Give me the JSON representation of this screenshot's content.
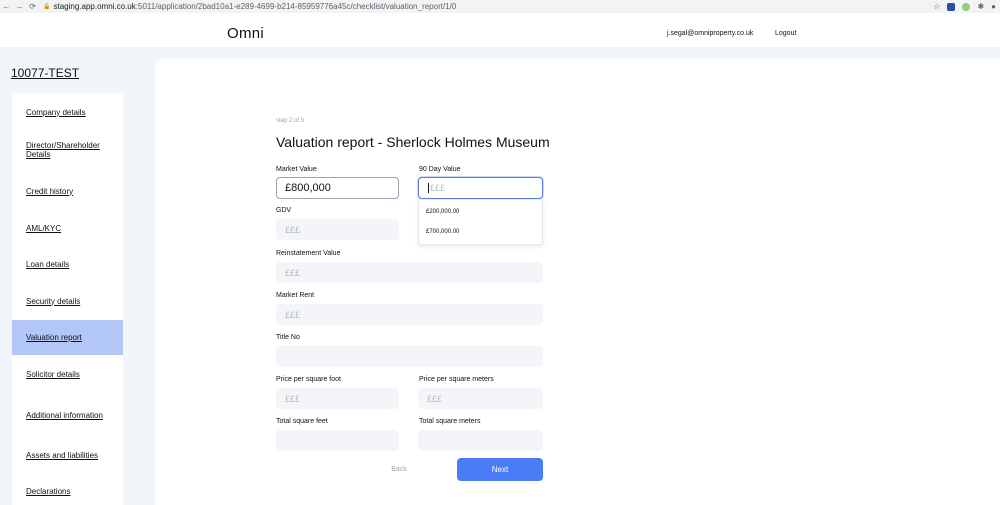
{
  "browser": {
    "url_host": "staging.app.omni.co.uk",
    "url_path": ":5011/application/2bad10a1-e289-4699-b214-85959776a45c/checklist/valuation_report/1/0"
  },
  "header": {
    "brand": "Omni",
    "user_email": "j.segal@omniproperty.co.uk",
    "logout_label": "Logout"
  },
  "application_id": "10077-TEST",
  "sidebar": {
    "items": [
      {
        "label": "Company details"
      },
      {
        "label": "Director/Shareholder Details"
      },
      {
        "label": "Credit history"
      },
      {
        "label": "AML/KYC"
      },
      {
        "label": "Loan details"
      },
      {
        "label": "Security details"
      },
      {
        "label": "Valuation report"
      },
      {
        "label": "Solicitor details"
      },
      {
        "label": "Additional information"
      },
      {
        "label": "Assets and liabilities"
      },
      {
        "label": "Declarations"
      }
    ],
    "active_item": "Valuation report"
  },
  "form": {
    "step": "step 2 of 5",
    "title": "Valuation report - Sherlock Holmes Museum",
    "market_value": {
      "label": "Market Value",
      "value": "£800,000"
    },
    "day90_value": {
      "label": "90 Day Value",
      "placeholder": "£££"
    },
    "gdv": {
      "label": "GDV",
      "placeholder": "£££"
    },
    "reinstatement_value": {
      "label": "Reinstatement Value",
      "placeholder": "£££"
    },
    "market_rent": {
      "label": "Market Rent",
      "placeholder": "£££"
    },
    "title_no": {
      "label": "Title No",
      "placeholder": ""
    },
    "price_sq_foot": {
      "label": "Price per square foot",
      "placeholder": "£££"
    },
    "price_sq_meters": {
      "label": "Price per square meters",
      "placeholder": "£££"
    },
    "total_sq_feet": {
      "label": "Total square feet",
      "placeholder": ""
    },
    "total_sq_meters": {
      "label": "Total square meters",
      "placeholder": ""
    }
  },
  "dropdown": {
    "options": [
      "£200,000.00",
      "£700,000.00"
    ]
  },
  "buttons": {
    "back": "Back",
    "next": "Next"
  },
  "colors": {
    "accent": "#4a7cf6",
    "active_sidebar": "#b3c7f7",
    "page_background": "#f2f5fa"
  }
}
